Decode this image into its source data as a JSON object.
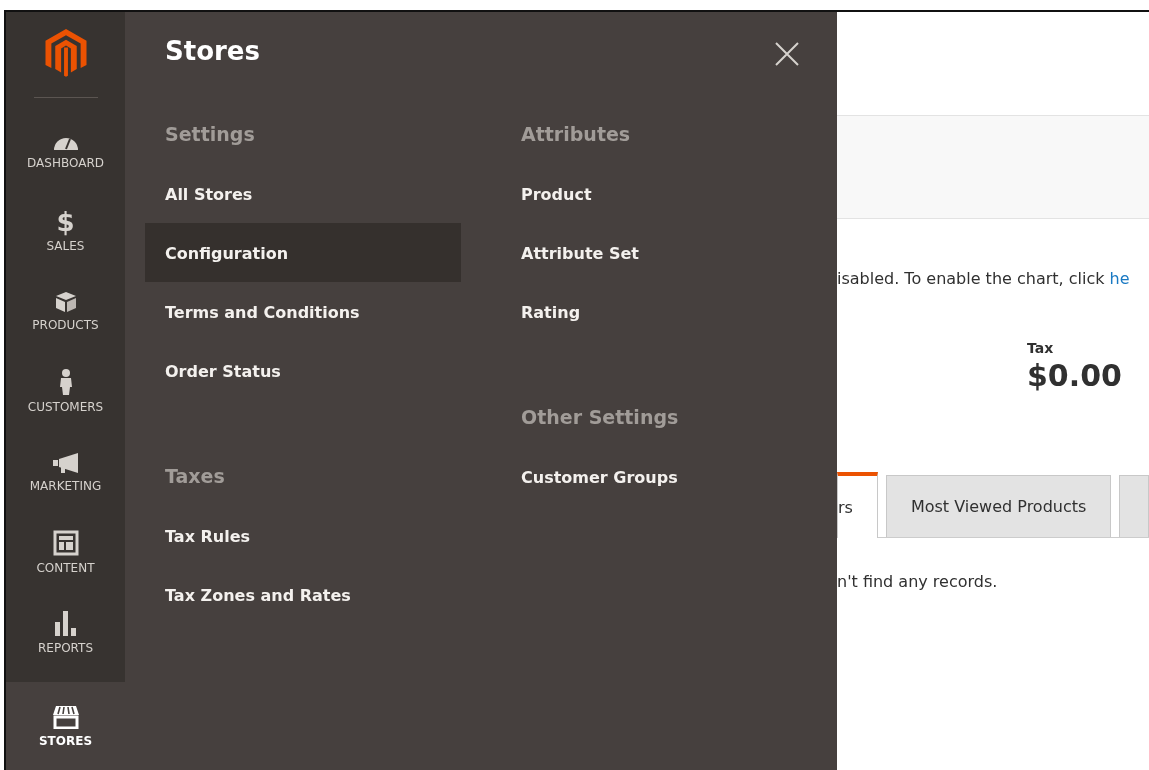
{
  "sidebar": {
    "items": [
      {
        "label": "DASHBOARD",
        "selected": false
      },
      {
        "label": "SALES",
        "glyph": "$",
        "selected": false
      },
      {
        "label": "PRODUCTS",
        "selected": false
      },
      {
        "label": "CUSTOMERS",
        "selected": false
      },
      {
        "label": "MARKETING",
        "selected": false
      },
      {
        "label": "CONTENT",
        "selected": false
      },
      {
        "label": "REPORTS",
        "selected": false
      },
      {
        "label": "STORES",
        "selected": true
      }
    ]
  },
  "flyout": {
    "title": "Stores",
    "columns": [
      {
        "groups": [
          {
            "heading": "Settings",
            "items": [
              {
                "label": "All Stores",
                "selected": false
              },
              {
                "label": "Configuration",
                "selected": true
              },
              {
                "label": "Terms and Conditions",
                "selected": false
              },
              {
                "label": "Order Status",
                "selected": false
              }
            ]
          },
          {
            "heading": "Taxes",
            "items": [
              {
                "label": "Tax Rules",
                "selected": false
              },
              {
                "label": "Tax Zones and Rates",
                "selected": false
              }
            ]
          }
        ]
      },
      {
        "groups": [
          {
            "heading": "Attributes",
            "items": [
              {
                "label": "Product",
                "selected": false
              },
              {
                "label": "Attribute Set",
                "selected": false
              },
              {
                "label": "Rating",
                "selected": false
              }
            ]
          },
          {
            "heading": "Other Settings",
            "items": [
              {
                "label": "Customer Groups",
                "selected": false
              }
            ]
          }
        ]
      }
    ]
  },
  "content": {
    "notice": {
      "text": "isabled. To enable the chart, click ",
      "link": "he"
    },
    "tax": {
      "label": "Tax",
      "value": "$0.00"
    },
    "tabs": [
      {
        "label": "rs",
        "selected": true
      },
      {
        "label": "Most Viewed Products",
        "selected": false
      },
      {
        "selected": false
      }
    ],
    "empty_message": "n't find any records."
  }
}
